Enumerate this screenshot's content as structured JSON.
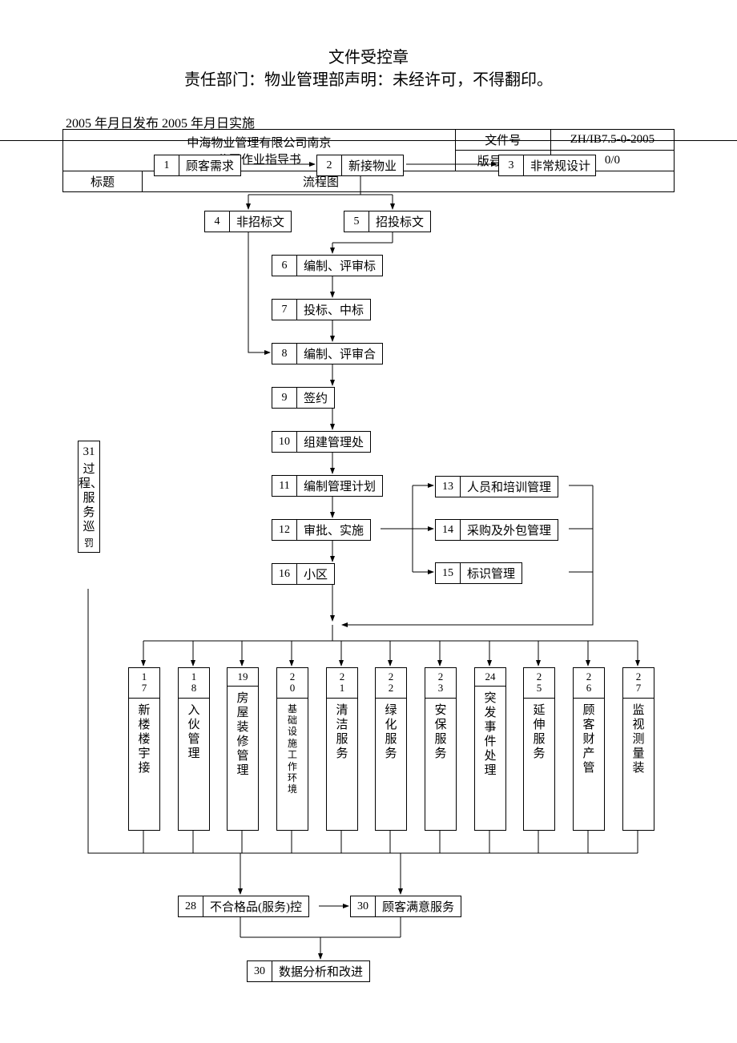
{
  "header": {
    "t1": "文件受控章",
    "t2": "责任部门：物业管理部声明：未经许可，不得翻印。",
    "dates": "2005 年月日发布 2005 年月日实施"
  },
  "table": {
    "company": "中海物业管理有限公司南京",
    "sub": "公司作业指导书",
    "title_lbl": "标题",
    "flow": "流程图",
    "docno_lbl": "文件号",
    "docno": "ZH/IB7.5-0-2005",
    "ver_lbl": "版号/状态",
    "ver": "0/0"
  },
  "n": {
    "1": {
      "n": "1",
      "t": "顾客需求"
    },
    "2": {
      "n": "2",
      "t": "新接物业"
    },
    "3": {
      "n": "3",
      "t": "非常规设计"
    },
    "4": {
      "n": "4",
      "t": "非招标文"
    },
    "5": {
      "n": "5",
      "t": "招投标文"
    },
    "6": {
      "n": "6",
      "t": "编制、评审标"
    },
    "7": {
      "n": "7",
      "t": "投标、中标"
    },
    "8": {
      "n": "8",
      "t": "编制、评审合"
    },
    "9": {
      "n": "9",
      "t": "签约"
    },
    "10": {
      "n": "10",
      "t": "组建管理处"
    },
    "11": {
      "n": "11",
      "t": "编制管理计划"
    },
    "12": {
      "n": "12",
      "t": "审批、实施"
    },
    "13": {
      "n": "13",
      "t": "人员和培训管理"
    },
    "14": {
      "n": "14",
      "t": "采购及外包管理"
    },
    "15": {
      "n": "15",
      "t": "标识管理"
    },
    "16": {
      "n": "16",
      "t": "小区"
    },
    "28": {
      "n": "28",
      "t": "不合格品(服务)控"
    },
    "30a": {
      "n": "30",
      "t": "顾客满意服务"
    },
    "30b": {
      "n": "30",
      "t": "数据分析和改进"
    }
  },
  "v": {
    "17": {
      "n": "17",
      "t": "新楼楼宇接"
    },
    "18": {
      "n": "18",
      "t": "入伙管理"
    },
    "19": {
      "n": "19",
      "t": "房屋装修管理"
    },
    "20": {
      "n": "20",
      "t": "基础设施工作环境",
      "small": true
    },
    "21": {
      "n": "21",
      "t": "清洁服务"
    },
    "22": {
      "n": "22",
      "t": "绿化服务"
    },
    "23": {
      "n": "23",
      "t": "安保服务"
    },
    "24": {
      "n": "24",
      "t": "突发事件处理"
    },
    "25": {
      "n": "25",
      "t": "延伸服务"
    },
    "26": {
      "n": "26",
      "t": "顾客财产管"
    },
    "27": {
      "n": "27",
      "t": "监视测量装"
    }
  },
  "side": {
    "n": "31",
    "t": "过程、服务巡",
    "extra": "罚"
  }
}
